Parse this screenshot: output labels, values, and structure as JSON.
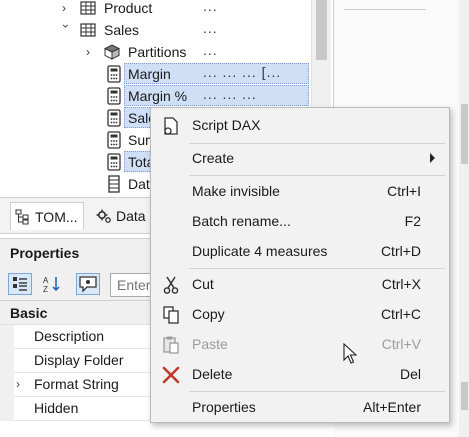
{
  "tree": {
    "items": [
      {
        "label": "Product",
        "dots": "..."
      },
      {
        "label": "Sales",
        "dots": "..."
      },
      {
        "label": "Partitions",
        "dots": "..."
      },
      {
        "label": "Margin",
        "dots": "...   ...   ...   [..."
      },
      {
        "label": "Margin %",
        "dots": "...   ...   ..."
      },
      {
        "label": "Sale",
        "dots": ""
      },
      {
        "label": "Sum",
        "dots": ""
      },
      {
        "label": "Tota",
        "dots": ""
      },
      {
        "label": "Dat",
        "dots": ""
      }
    ]
  },
  "tabs": {
    "tom": "TOM...",
    "data": "Data"
  },
  "properties": {
    "title": "Properties",
    "search_placeholder": "Enter",
    "category": "Basic",
    "rows": [
      "Description",
      "Display Folder",
      "Format String",
      "Hidden"
    ]
  },
  "menu": {
    "script_dax": "Script DAX",
    "create": "Create",
    "make_invisible": "Make invisible",
    "make_invisible_sc": "Ctrl+I",
    "batch_rename": "Batch rename...",
    "batch_rename_sc": "F2",
    "duplicate": "Duplicate 4 measures",
    "duplicate_sc": "Ctrl+D",
    "cut": "Cut",
    "cut_sc": "Ctrl+X",
    "copy": "Copy",
    "copy_sc": "Ctrl+C",
    "paste": "Paste",
    "paste_sc": "Ctrl+V",
    "delete": "Delete",
    "delete_sc": "Del",
    "properties": "Properties",
    "properties_sc": "Alt+Enter"
  },
  "colors": {
    "selection": "#cfe0f6",
    "delete_icon": "#c0392b",
    "menu_bg": "#f2f2f2"
  }
}
